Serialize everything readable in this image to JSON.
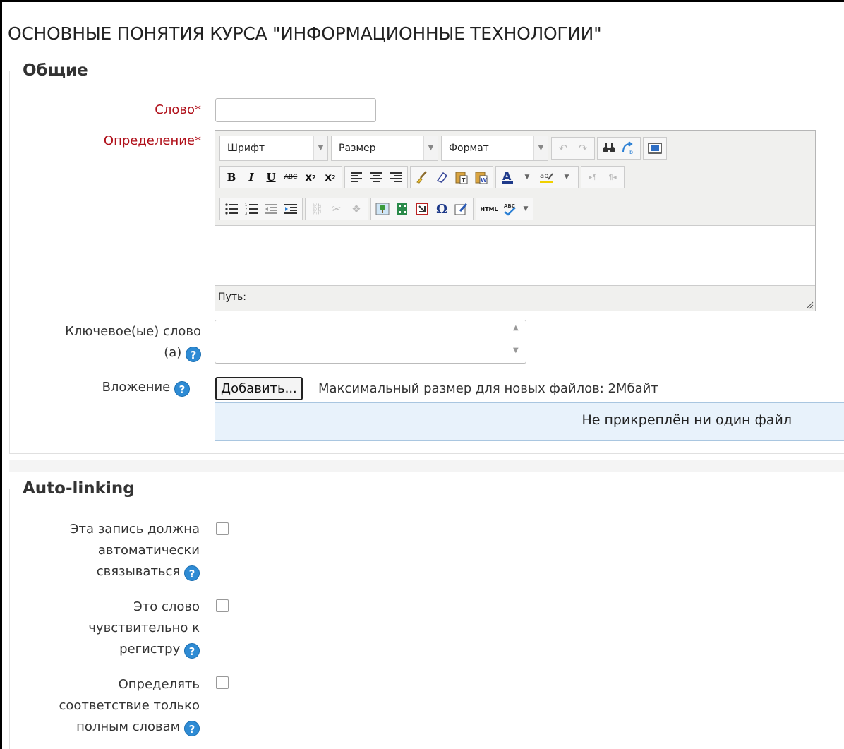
{
  "page_title": "ОСНОВНЫЕ ПОНЯТИЯ КУРСА \"ИНФОРМАЦИОННЫЕ ТЕХНОЛОГИИ\"",
  "general": {
    "legend": "Общие",
    "word_label": "Слово",
    "definition_label": "Определение",
    "required_mark": "*",
    "word_value": "",
    "editor": {
      "font_select": "Шрифт",
      "size_select": "Размер",
      "format_select": "Формат",
      "path_label": "Путь:"
    },
    "keywords_label_line1": "Ключевое(ые) слово",
    "keywords_label_line2": "(а)",
    "attachment_label": "Вложение",
    "add_button": "Добавить...",
    "max_size_text": "Максимальный размер для новых файлов: 2Мбайт",
    "no_files_text": "Не прикреплён ни один файл"
  },
  "autolinking": {
    "legend": "Auto-linking",
    "option1": [
      "Эта запись должна",
      "автоматически",
      "связываться"
    ],
    "option2": [
      "Это слово",
      "чувствительно к",
      "регистру"
    ],
    "option3": [
      "Определять",
      "соответствие только",
      "полным словам"
    ],
    "option1_checked": false,
    "option2_checked": false,
    "option3_checked": false
  },
  "help_glyph": "?",
  "colors": {
    "required": "#b0101a",
    "help_icon": "#2e8bd4",
    "file_area_bg": "#e8f2fb"
  }
}
